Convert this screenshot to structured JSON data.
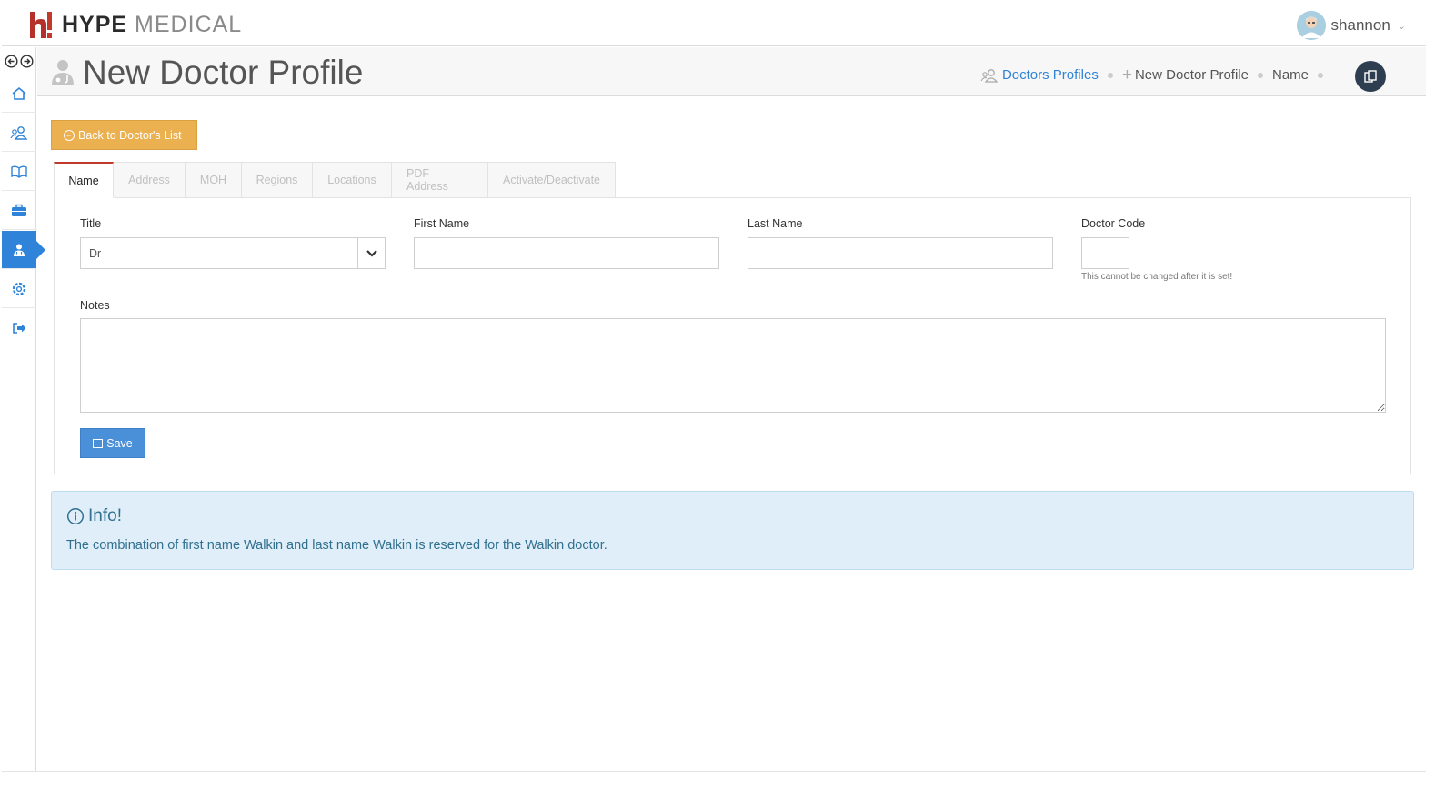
{
  "brand": {
    "mark": "h!",
    "word1": "HYPE",
    "word2": "MEDICAL"
  },
  "user": {
    "name": "shannon"
  },
  "sidebar": {
    "items": [
      {
        "icon": "home-icon"
      },
      {
        "icon": "users-icon"
      },
      {
        "icon": "book-icon"
      },
      {
        "icon": "briefcase-icon"
      },
      {
        "icon": "doctor-icon",
        "active": true
      },
      {
        "icon": "gear-icon"
      },
      {
        "icon": "logout-icon"
      }
    ]
  },
  "page": {
    "title": "New Doctor Profile"
  },
  "breadcrumb": {
    "item1": "Doctors Profiles",
    "item2": "New Doctor Profile",
    "item3": "Name"
  },
  "actions": {
    "back_label": "Back to Doctor's List",
    "save_label": "Save"
  },
  "tabs": [
    "Name",
    "Address",
    "MOH",
    "Regions",
    "Locations",
    "PDF Address",
    "Activate/Deactivate"
  ],
  "form": {
    "title_label": "Title",
    "title_value": "Dr",
    "first_name_label": "First Name",
    "first_name_value": "",
    "last_name_label": "Last Name",
    "last_name_value": "",
    "doctor_code_label": "Doctor Code",
    "doctor_code_value": "",
    "doctor_code_help": "This cannot be changed after it is set!",
    "notes_label": "Notes",
    "notes_value": ""
  },
  "alert": {
    "title": "Info!",
    "text": "The combination of first name Walkin and last name Walkin is reserved for the Walkin doctor."
  },
  "colors": {
    "accent": "#2f83d8",
    "back_button": "#ebb04f",
    "save_button": "#4a90d9",
    "active_tab_border": "#c0392b",
    "alert_bg": "#dfeef8",
    "alert_text": "#31708f"
  }
}
